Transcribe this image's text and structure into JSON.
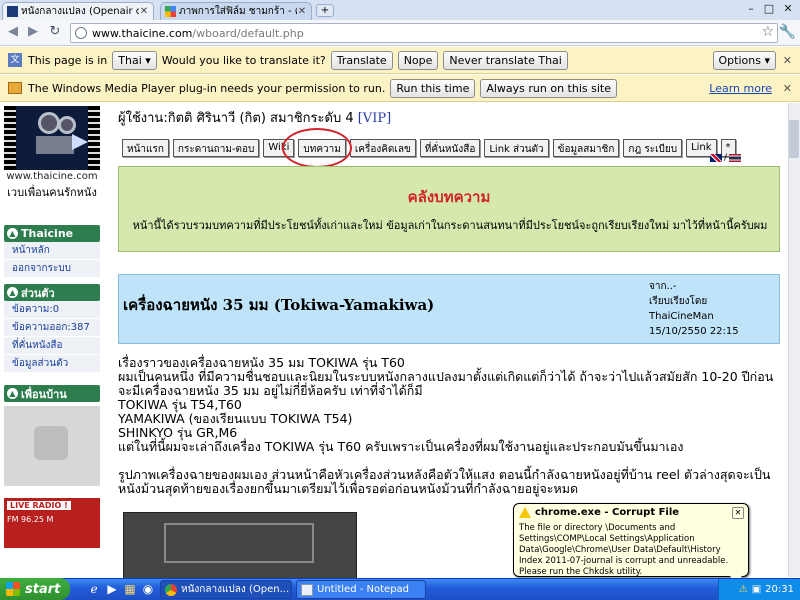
{
  "browser": {
    "tabs": [
      {
        "title": "หนังกลางแปลง (Openair cinema)"
      },
      {
        "title": "ภาพการใส่ฟิล์ม ชามกร้า - ค้นห"
      }
    ],
    "new_tab": "+",
    "window_controls": {
      "minimize": "–",
      "maximize": "□",
      "close": "✕"
    },
    "url_host": "www.thaicine.com",
    "url_path": "/wboard/default.php"
  },
  "translate_bar": {
    "prefix": "This page is in",
    "language": "Thai",
    "question": "Would you like to translate it?",
    "translate": "Translate",
    "nope": "Nope",
    "never": "Never translate Thai",
    "options": "Options"
  },
  "plugin_bar": {
    "message": "The Windows Media Player plug-in needs your permission to run.",
    "run_once": "Run this time",
    "always": "Always run on this site",
    "learn_more": "Learn more"
  },
  "sidebar": {
    "logo_url": "www.thaicine.com",
    "logo_tagline": "เวบเพื่อนคนรักหนัง",
    "section1": {
      "title": "Thaicine",
      "items": [
        "หน้าหลัก",
        "ออกจากระบบ"
      ]
    },
    "section2": {
      "title": "ส่วนตัว",
      "items": [
        "ข้อความ:0",
        "ข้อความออก:387",
        "ที่คั่นหนังสือ",
        "ข้อมูลส่วนตัว"
      ]
    },
    "section3": {
      "title": "เพื่อนบ้าน"
    },
    "radio": {
      "live": "LIVE RADIO !",
      "freq": "FM 96.25 M"
    }
  },
  "main": {
    "user_line": "ผู้ใช้งาน:กิตติ ศิรินาวี (กิต) สมาชิกระดับ 4",
    "vip": "[VIP]",
    "nav": [
      "หน้าแรก",
      "กระดานถาม-ตอบ",
      "Wiki",
      "บทความ",
      "เครื่องคิดเลข",
      "ที่คั่นหนังสือ",
      "Link ส่วนตัว",
      "ข้อมูลสมาชิก",
      "กฎ ระเบียบ",
      "Link",
      "*"
    ],
    "banner_title": "คลังบทความ",
    "banner_desc": "หน้านี้ได้รวบรวมบทความที่มีประโยชน์ทั้งเก่าและใหม่ ข้อมูลเก่าในกระดานสนทนาที่มีประโยชน์จะถูกเรียบเรียงใหม่ มาไว้ที่หน้านี้ครับผม",
    "article": {
      "title": "เครื่องฉายหนัง 35 มม (Tokiwa-Yamakiwa)",
      "meta": [
        "จาก..-",
        "เรียบเรียงโดย",
        "ThaiCineMan",
        "15/10/2550 22:15"
      ],
      "body": [
        "เรื่องราวของเครื่องฉายหนัง 35 มม TOKIWA รุ่น T60",
        "ผมเป็นคนหนึ่ง ที่มีความชื่นชอบและนิยมในระบบหนังกลางแปลงมาตั้งแต่เกิดแต่ก็ว่าได้ ถ้าจะว่าไปแล้วสมัยสัก 10-20 ปีก่อนจะมีเครื่องฉายหนัง 35 มม อยู่ไม่กี่ยี่ห้อครับ เท่าที่จำได้ก็มี",
        "TOKIWA รุ่น T54,T60",
        "YAMAKIWA (ของเรียนแบบ TOKIWA T54)",
        "SHINKYO รุ่น GR,M6",
        "แต่ในที่นี้ผมจะเล่าถึงเครื่อง TOKIWA รุ่น T60 ครับเพราะเป็นเครื่องที่ผมใช้งานอยู่และประกอบมันขึ้นมาเอง",
        "",
        "รูปภาพเครื่องฉายของผมเอง ส่วนหน้าคือหัวเครื่องส่วนหลังคือตัวให้แสง ตอนนี้กำลังฉายหนังอยู่ที่บ้าน reel ตัวล่างสุดจะเป็นหนังม้วนสุดท้ายของเรื่องยกขึ้นมาเตรียมไว้เพื่อรอต่อก่อนหนังม้วนที่กำลังฉายอยู่จะหมด"
      ]
    }
  },
  "dialog": {
    "title": "chrome.exe - Corrupt File",
    "message": "The file or directory \\Documents and Settings\\COMP\\Local Settings\\Application Data\\Google\\Chrome\\User Data\\Default\\History Index 2011-07-journal is corrupt and unreadable. Please run the Chkdsk utility."
  },
  "taskbar": {
    "start": "start",
    "tasks": [
      "หนังกลางแปลง (Open...",
      "Untitled - Notepad"
    ],
    "clock": "20:31"
  }
}
